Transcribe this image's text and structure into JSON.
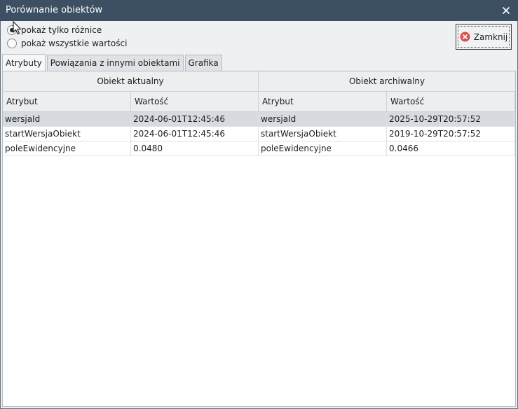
{
  "window": {
    "title": "Porównanie obiektów"
  },
  "options": [
    {
      "label": "pokaż tylko różnice",
      "checked": true
    },
    {
      "label": "pokaż wszystkie wartości",
      "checked": false
    }
  ],
  "close_button": {
    "label": "Zamknij",
    "icon": "close-circle-icon"
  },
  "tabs": [
    {
      "label": "Atrybuty",
      "active": true
    },
    {
      "label": "Powiązania z innymi obiektami",
      "active": false
    },
    {
      "label": "Grafika",
      "active": false
    }
  ],
  "table": {
    "groups": [
      "Obiekt aktualny",
      "Obiekt archiwalny"
    ],
    "columns": [
      "Atrybut",
      "Wartość",
      "Atrybut",
      "Wartość"
    ],
    "rows": [
      [
        "wersjaId",
        "2024-06-01T12:45:46",
        "wersjaId",
        "2025-10-29T20:57:52"
      ],
      [
        "startWersjaObiekt",
        "2024-06-01T12:45:46",
        "startWersjaObiekt",
        "2019-10-29T20:57:52"
      ],
      [
        "poleEwidencyjne",
        "0.0480",
        "poleEwidencyjne",
        "0.0466"
      ]
    ],
    "selected_row": 0
  },
  "colors": {
    "titlebar": "#3c4f63",
    "close_icon": "#d9534f"
  }
}
